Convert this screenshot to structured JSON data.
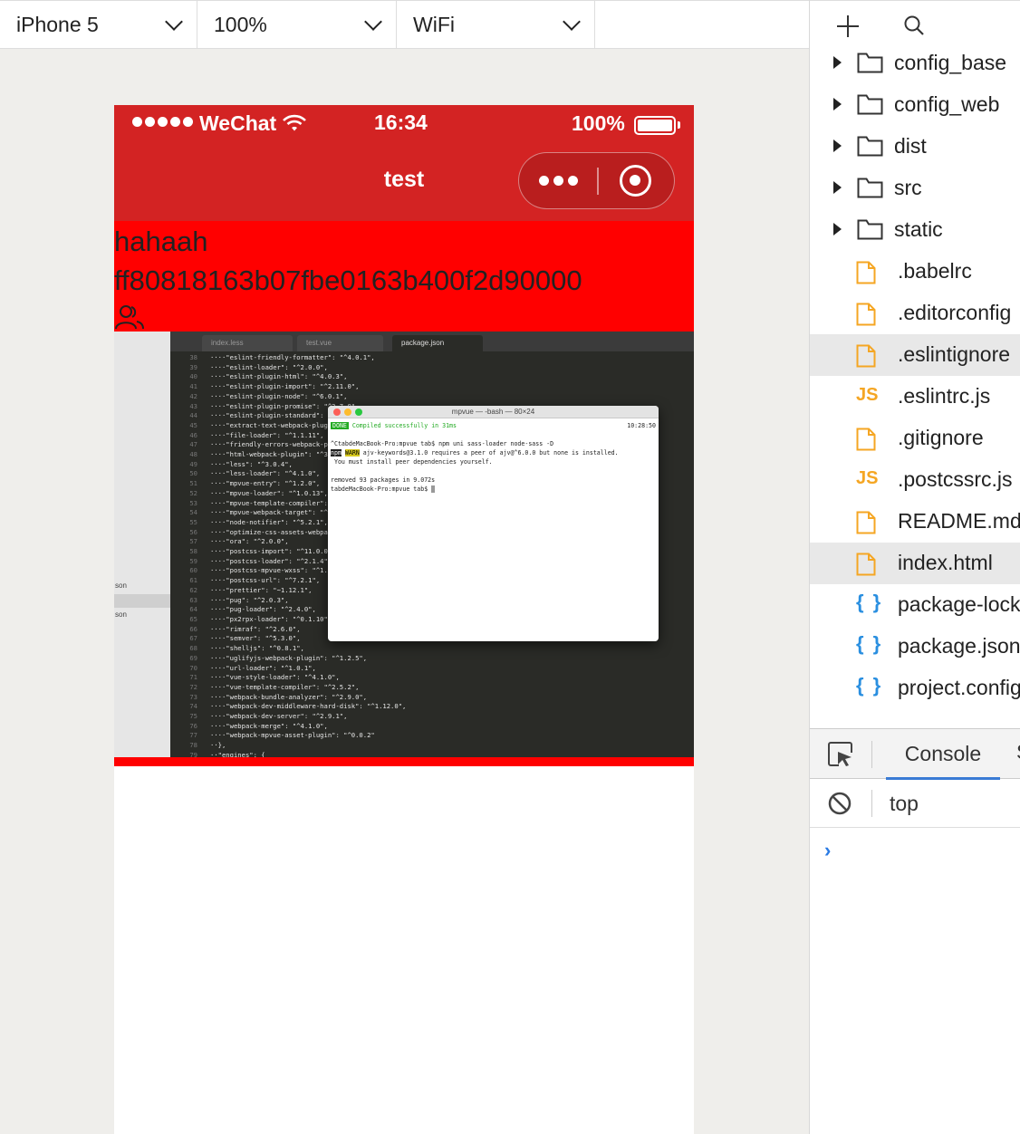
{
  "toolbar": {
    "device": "iPhone 5",
    "zoom": "100%",
    "network": "WiFi"
  },
  "phone": {
    "status": {
      "carrier": "WeChat",
      "time": "16:34",
      "battery": "100%"
    },
    "nav": {
      "title": "test"
    },
    "content": {
      "line1": "hahaah",
      "line2": "ff80818163b07fbe0163b400f2d90000"
    },
    "embedded": {
      "tabs": [
        "index.less",
        "test.vue",
        "package.json"
      ],
      "left_labels": [
        "son",
        "son"
      ],
      "code_lines": [
        [
          "38",
          "····\"eslint-friendly-formatter\": \"^4.0.1\","
        ],
        [
          "39",
          "····\"eslint-loader\": \"^2.0.0\","
        ],
        [
          "40",
          "····\"eslint-plugin-html\": \"^4.0.3\","
        ],
        [
          "41",
          "····\"eslint-plugin-import\": \"^2.11.0\","
        ],
        [
          "42",
          "····\"eslint-plugin-node\": \"^6.0.1\","
        ],
        [
          "43",
          "····\"eslint-plugin-promise\": \"^3.7.0\","
        ],
        [
          "44",
          "····\"eslint-plugin-standard\": \"^3.1.0\","
        ],
        [
          "45",
          "····\"extract-text-webpack-plugin\": \"^3.0.2\","
        ],
        [
          "46",
          "····\"file-loader\": \"^1.1.11\","
        ],
        [
          "47",
          "····\"friendly-errors-webpack-plugin\": \"^1.7.0\","
        ],
        [
          "48",
          "····\"html-webpack-plugin\": \"^3.2.0\","
        ],
        [
          "49",
          "····\"less\": \"^3.0.4\","
        ],
        [
          "50",
          "····\"less-loader\": \"^4.1.0\","
        ],
        [
          "51",
          "····\"mpvue-entry\": \"^1.2.0\","
        ],
        [
          "52",
          "····\"mpvue-loader\": \"^1.0.13\","
        ],
        [
          "53",
          "····\"mpvue-template-compiler\": \"^1.0.11\","
        ],
        [
          "54",
          "····\"mpvue-webpack-target\": \"^1.0.0\","
        ],
        [
          "55",
          "····\"node-notifier\": \"^5.2.1\","
        ],
        [
          "56",
          "····\"optimize-css-assets-webpack-plugin\": \"^4.0.1\","
        ],
        [
          "57",
          "····\"ora\": \"^2.0.0\","
        ],
        [
          "58",
          "····\"postcss-import\": \"^11.0.0\","
        ],
        [
          "59",
          "····\"postcss-loader\": \"^2.1.4\","
        ],
        [
          "60",
          "····\"postcss-mpvue-wxss\": \"^1.0.0\","
        ],
        [
          "61",
          "····\"postcss-url\": \"^7.2.1\","
        ],
        [
          "62",
          "····\"prettier\": \"~1.12.1\","
        ],
        [
          "63",
          "····\"pug\": \"^2.0.3\","
        ],
        [
          "64",
          "····\"pug-loader\": \"^2.4.0\","
        ],
        [
          "65",
          "····\"px2rpx-loader\": \"^0.1.10\","
        ],
        [
          "66",
          "····\"rimraf\": \"^2.6.0\","
        ],
        [
          "67",
          "····\"semver\": \"^5.3.0\","
        ],
        [
          "68",
          "····\"shelljs\": \"^0.8.1\","
        ],
        [
          "69",
          "····\"uglifyjs-webpack-plugin\": \"^1.2.5\","
        ],
        [
          "70",
          "····\"url-loader\": \"^1.0.1\","
        ],
        [
          "71",
          "····\"vue-style-loader\": \"^4.1.0\","
        ],
        [
          "72",
          "····\"vue-template-compiler\": \"^2.5.2\","
        ],
        [
          "73",
          "····\"webpack-bundle-analyzer\": \"^2.9.0\","
        ],
        [
          "74",
          "····\"webpack-dev-middleware-hard-disk\": \"^1.12.0\","
        ],
        [
          "75",
          "····\"webpack-dev-server\": \"^2.9.1\","
        ],
        [
          "76",
          "····\"webpack-merge\": \"^4.1.0\","
        ],
        [
          "77",
          "····\"webpack-mpvue-asset-plugin\": \"^0.0.2\""
        ],
        [
          "78",
          "··},"
        ],
        [
          "79",
          "··\"engines\": {"
        ]
      ],
      "terminal": {
        "title": "mpvue — -bash — 80×24",
        "done": "DONE",
        "compiled": " Compiled successfully in 31ms",
        "clock": "10:28:50",
        "cmd": "^CtabdeMacBook-Pro:mpvue tab$ npm uni sass-loader node-sass -D",
        "npm": "npm",
        "warn": "WARN",
        "warn_msg": " ajv-keywords@3.1.0 requires a peer of ajv@^6.0.0 but none is installed.",
        "warn_msg2": " You must install peer dependencies yourself.",
        "removed": "removed 93 packages in 9.072s",
        "prompt": "tabdeMacBook-Pro:mpvue tab$ "
      }
    }
  },
  "tree": [
    {
      "type": "folder",
      "name": "config_base"
    },
    {
      "type": "folder",
      "name": "config_web"
    },
    {
      "type": "folder",
      "name": "dist"
    },
    {
      "type": "folder",
      "name": "src"
    },
    {
      "type": "folder",
      "name": "static"
    },
    {
      "type": "file",
      "name": ".babelrc"
    },
    {
      "type": "file",
      "name": ".editorconfig"
    },
    {
      "type": "file",
      "name": ".eslintignore"
    },
    {
      "type": "js",
      "name": ".eslintrc.js"
    },
    {
      "type": "file",
      "name": ".gitignore"
    },
    {
      "type": "js",
      "name": ".postcssrc.js"
    },
    {
      "type": "file",
      "name": "README.md"
    },
    {
      "type": "file",
      "name": "index.html"
    },
    {
      "type": "json",
      "name": "package-lock.json"
    },
    {
      "type": "json",
      "name": "package.json"
    },
    {
      "type": "json",
      "name": "project.config.json"
    }
  ],
  "tree_icons": {
    "js": "JS",
    "json": "{ }"
  },
  "console": {
    "tab": "Console",
    "next_tab": "S",
    "context": "top",
    "prompt": "›"
  },
  "colors": {
    "nav_red": "#d32323",
    "content_red": "#ff0000",
    "file_icon": "#f5a623",
    "json_icon": "#2a8fe0",
    "tab_underline": "#3a7bd5"
  }
}
